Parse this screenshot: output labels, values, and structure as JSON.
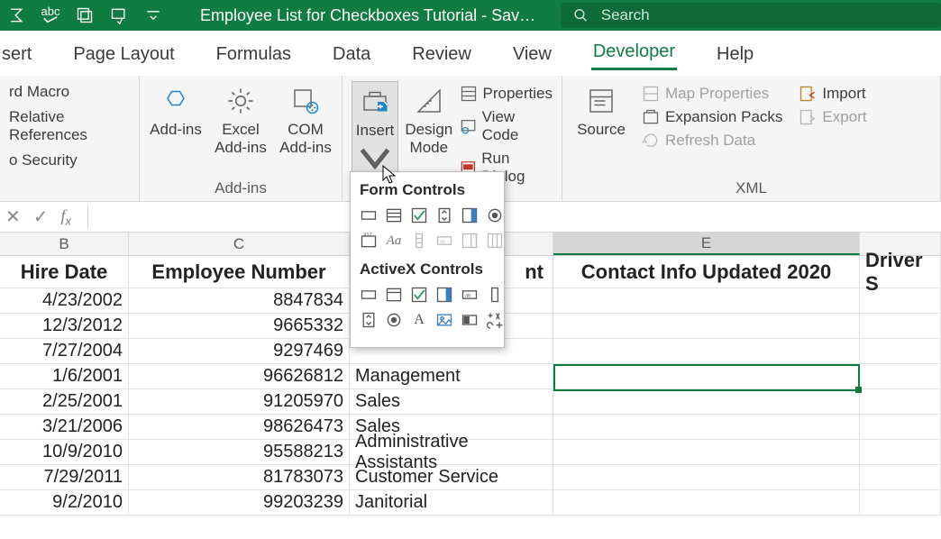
{
  "title": "Employee List for Checkboxes Tutorial  -  Sav…",
  "search": {
    "placeholder": "Search"
  },
  "tabs": [
    "sert",
    "Page Layout",
    "Formulas",
    "Data",
    "Review",
    "View",
    "Developer",
    "Help"
  ],
  "active_tab": "Developer",
  "ribbon": {
    "code": {
      "lines": [
        "rd Macro",
        "Relative References",
        "o Security"
      ]
    },
    "addins": {
      "label": "Add-ins",
      "items": [
        "Add-ins",
        "Excel Add-ins",
        "COM Add-ins"
      ]
    },
    "controls": {
      "insert": "Insert",
      "design": "Design Mode",
      "properties": "Properties",
      "view_code": "View Code",
      "run_dialog": "Run Dialog"
    },
    "xml": {
      "label": "XML",
      "source": "Source",
      "map_properties": "Map Properties",
      "expansion_packs": "Expansion Packs",
      "refresh_data": "Refresh Data",
      "import": "Import",
      "export": "Export"
    }
  },
  "insert_dropdown": {
    "form": "Form Controls",
    "activex": "ActiveX Controls"
  },
  "columns": {
    "B": "B",
    "C": "C",
    "E": "E"
  },
  "headers": {
    "B": "Hire Date",
    "C": "Employee Number",
    "D_partial": "nt",
    "E": "Contact Info Updated 2020",
    "F": "Driver S"
  },
  "rows": [
    {
      "hire": "4/23/2002",
      "emp": "8847834",
      "dept": ""
    },
    {
      "hire": "12/3/2012",
      "emp": "9665332",
      "dept": ""
    },
    {
      "hire": "7/27/2004",
      "emp": "9297469",
      "dept": ""
    },
    {
      "hire": "1/6/2001",
      "emp": "96626812",
      "dept": "Management"
    },
    {
      "hire": "2/25/2001",
      "emp": "91205970",
      "dept": "Sales"
    },
    {
      "hire": "3/21/2006",
      "emp": "98626473",
      "dept": "Sales"
    },
    {
      "hire": "10/9/2010",
      "emp": "95588213",
      "dept": "Administrative Assistants"
    },
    {
      "hire": "7/29/2011",
      "emp": "81783073",
      "dept": "Customer Service"
    },
    {
      "hire": "9/2/2010",
      "emp": "99203239",
      "dept": "Janitorial"
    }
  ],
  "selected_cell": {
    "col": "E",
    "row_index": 3
  }
}
